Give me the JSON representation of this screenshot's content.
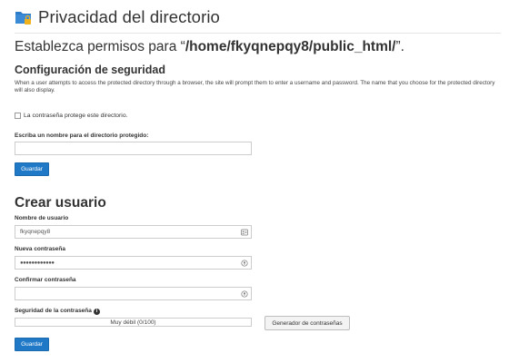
{
  "header": {
    "title": "Privacidad del directorio",
    "icon": "folder-lock-icon"
  },
  "permissions": {
    "heading_prefix": "Establezca permisos para “",
    "path": "/home/fkyqnepqy8/public_html/",
    "heading_suffix": "”."
  },
  "security": {
    "title": "Configuración de seguridad",
    "description": "When a user attempts to access the protected directory through a browser, the site will prompt them to enter a username and password. The name that you choose for the protected directory will also display.",
    "checkbox_label": "La contraseña protege este directorio.",
    "checkbox_checked": false,
    "dir_name_label": "Escriba un nombre para el directorio protegido:",
    "dir_name_value": "",
    "save_label": "Guardar"
  },
  "create_user": {
    "title": "Crear usuario",
    "username_label": "Nombre de usuario",
    "username_value": "fkyqnepqy8",
    "new_password_label": "Nueva contraseña",
    "new_password_value": "●●●●●●●●●●●●",
    "confirm_password_label": "Confirmar contraseña",
    "confirm_password_value": "",
    "strength_label": "Seguridad de la contraseña",
    "strength_text": "Muy débil (0/100)",
    "strength_value": 0,
    "generator_label": "Generador de contraseñas",
    "save_label": "Guardar"
  },
  "colors": {
    "primary_button": "#1f79c7",
    "folder_blue": "#2d7cc7",
    "lock_yellow": "#f0b21c"
  }
}
